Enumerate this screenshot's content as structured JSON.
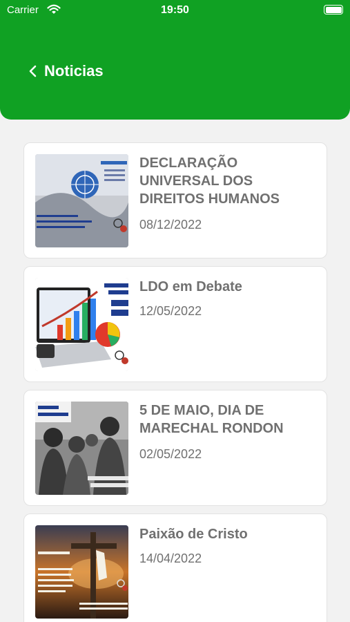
{
  "status_bar": {
    "carrier": "Carrier",
    "time": "19:50"
  },
  "nav": {
    "back_label": "Noticias"
  },
  "news": [
    {
      "title": "DECLARAÇÃO UNIVERSAL DOS DIREITOS HUMANOS",
      "date": "08/12/2022"
    },
    {
      "title": "LDO em Debate",
      "date": "12/05/2022"
    },
    {
      "title": "5 DE MAIO, DIA DE MARECHAL RONDON",
      "date": "02/05/2022"
    },
    {
      "title": "Paixão de Cristo",
      "date": "14/04/2022"
    }
  ],
  "colors": {
    "header": "#10a123",
    "text_muted": "#707070",
    "background": "#f2f2f2"
  }
}
